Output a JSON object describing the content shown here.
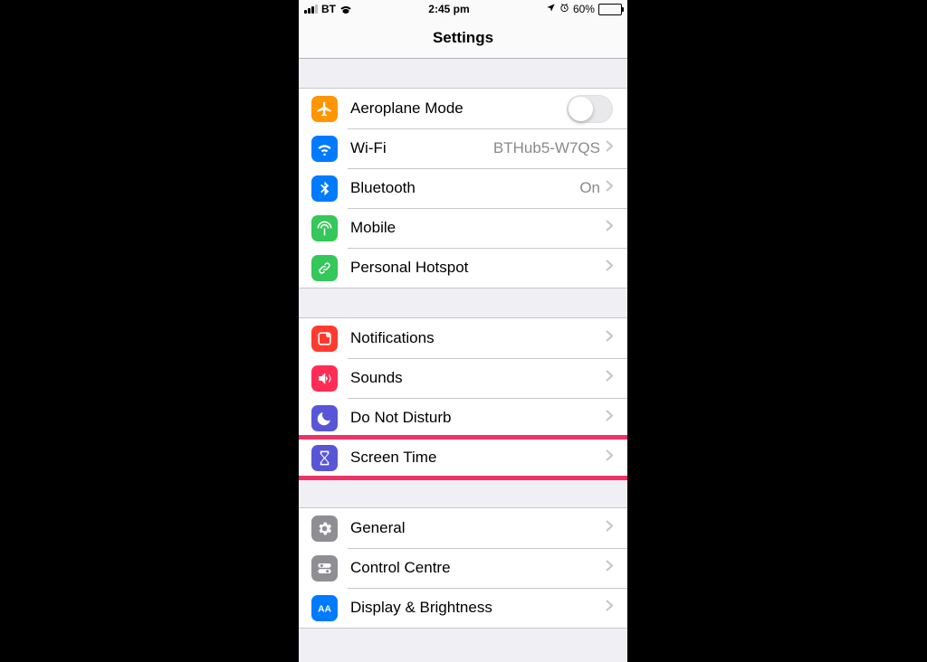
{
  "status": {
    "carrier": "BT",
    "time": "2:45 pm",
    "battery": "60%"
  },
  "title": "Settings",
  "groups": [
    {
      "rows": [
        {
          "icon": "airplane",
          "color": "c-orange",
          "label": "Aeroplane Mode",
          "accessory": "toggle",
          "toggle": false
        },
        {
          "icon": "wifi",
          "color": "c-blue",
          "label": "Wi-Fi",
          "accessory": "chevron",
          "detail": "BTHub5-W7QS"
        },
        {
          "icon": "bluetooth",
          "color": "c-blue",
          "label": "Bluetooth",
          "accessory": "chevron",
          "detail": "On"
        },
        {
          "icon": "antenna",
          "color": "c-green",
          "label": "Mobile",
          "accessory": "chevron"
        },
        {
          "icon": "link",
          "color": "c-green",
          "label": "Personal Hotspot",
          "accessory": "chevron"
        }
      ]
    },
    {
      "rows": [
        {
          "icon": "notification",
          "color": "c-red",
          "label": "Notifications",
          "accessory": "chevron"
        },
        {
          "icon": "speaker",
          "color": "c-pink",
          "label": "Sounds",
          "accessory": "chevron"
        },
        {
          "icon": "moon",
          "color": "c-indigo",
          "label": "Do Not Disturb",
          "accessory": "chevron"
        },
        {
          "icon": "hourglass",
          "color": "c-indigo",
          "label": "Screen Time",
          "accessory": "chevron",
          "highlight": true
        }
      ]
    },
    {
      "rows": [
        {
          "icon": "gear",
          "color": "c-gray",
          "label": "General",
          "accessory": "chevron"
        },
        {
          "icon": "switches",
          "color": "c-gray",
          "label": "Control Centre",
          "accessory": "chevron"
        },
        {
          "icon": "aa",
          "color": "c-blue",
          "label": "Display & Brightness",
          "accessory": "chevron"
        }
      ]
    }
  ]
}
